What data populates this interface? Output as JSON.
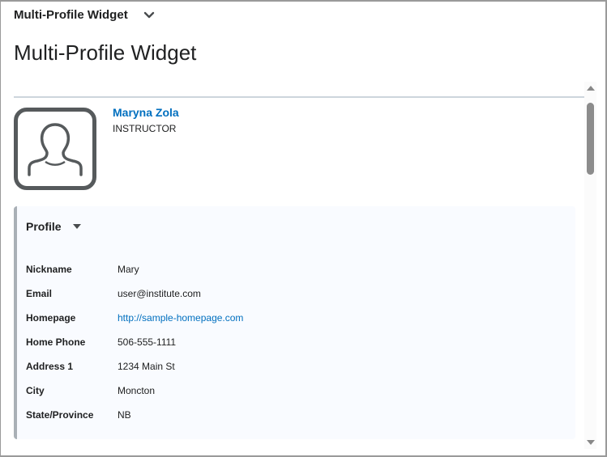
{
  "header": {
    "title": "Multi-Profile Widget"
  },
  "page": {
    "title": "Multi-Profile Widget"
  },
  "profile": {
    "name": "Maryna Zola",
    "role": "INSTRUCTOR",
    "section_label": "Profile",
    "fields": [
      {
        "label": "Nickname",
        "value": "Mary"
      },
      {
        "label": "Email",
        "value": "user@institute.com"
      },
      {
        "label": "Homepage",
        "value": "http://sample-homepage.com"
      },
      {
        "label": "Home Phone",
        "value": "506-555-1111"
      },
      {
        "label": "Address 1",
        "value": "1234 Main St"
      },
      {
        "label": "City",
        "value": "Moncton"
      },
      {
        "label": "State/Province",
        "value": "NB"
      }
    ]
  },
  "colors": {
    "link": "#006fbf"
  }
}
